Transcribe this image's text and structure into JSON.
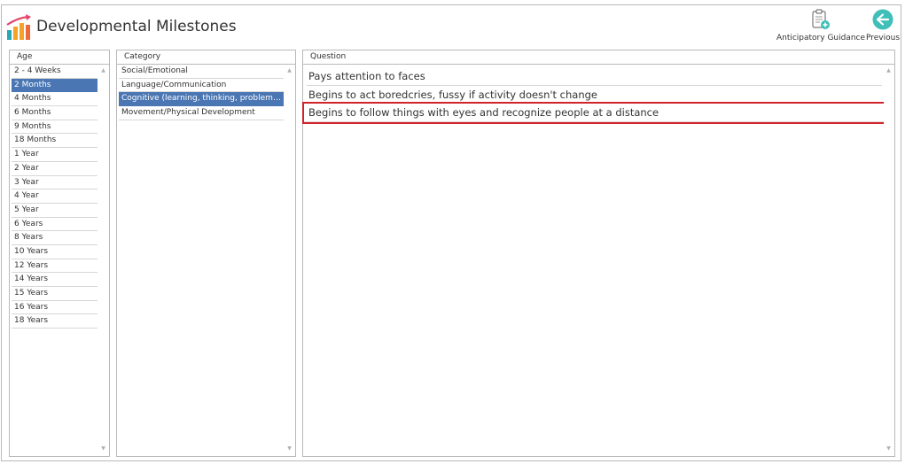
{
  "app": {
    "title": "Developmental Milestones"
  },
  "toolbar": {
    "guidance_label": "Anticipatory Guidance",
    "previous_label": "Previous"
  },
  "panels": {
    "age_header": "Age",
    "category_header": "Category",
    "question_header": "Question"
  },
  "ages": [
    {
      "label": "2 - 4 Weeks",
      "selected": false
    },
    {
      "label": "2 Months",
      "selected": true
    },
    {
      "label": "4 Months",
      "selected": false
    },
    {
      "label": "6 Months",
      "selected": false
    },
    {
      "label": "9 Months",
      "selected": false
    },
    {
      "label": "18 Months",
      "selected": false
    },
    {
      "label": "1 Year",
      "selected": false
    },
    {
      "label": "2 Year",
      "selected": false
    },
    {
      "label": "3 Year",
      "selected": false
    },
    {
      "label": "4 Year",
      "selected": false
    },
    {
      "label": "5 Year",
      "selected": false
    },
    {
      "label": "6 Years",
      "selected": false
    },
    {
      "label": "8 Years",
      "selected": false
    },
    {
      "label": "10 Years",
      "selected": false
    },
    {
      "label": "12 Years",
      "selected": false
    },
    {
      "label": "14 Years",
      "selected": false
    },
    {
      "label": "15 Years",
      "selected": false
    },
    {
      "label": "16 Years",
      "selected": false
    },
    {
      "label": "18 Years",
      "selected": false
    }
  ],
  "categories": [
    {
      "label": "Social/Emotional",
      "selected": false
    },
    {
      "label": "Language/Communication",
      "selected": false
    },
    {
      "label": "Cognitive (learning, thinking, problem-solvi...",
      "selected": true
    },
    {
      "label": "Movement/Physical Development",
      "selected": false
    }
  ],
  "questions": [
    {
      "label": "Pays attention to faces",
      "highlighted": false
    },
    {
      "label": "Begins to act boredcries, fussy if activity doesn't change",
      "highlighted": false
    },
    {
      "label": "Begins to follow things with eyes and recognize people at a distance",
      "highlighted": true
    }
  ],
  "colors": {
    "selection": "#4a76b3",
    "highlight_border": "#d3232a",
    "previous_button": "#3fbfb7"
  },
  "icons": {
    "logo": "bar-chart-trend-icon",
    "guidance": "clipboard-add-icon",
    "previous": "arrow-left-circle-icon",
    "scroll_up": "scroll-up-icon",
    "scroll_down": "scroll-down-icon"
  }
}
